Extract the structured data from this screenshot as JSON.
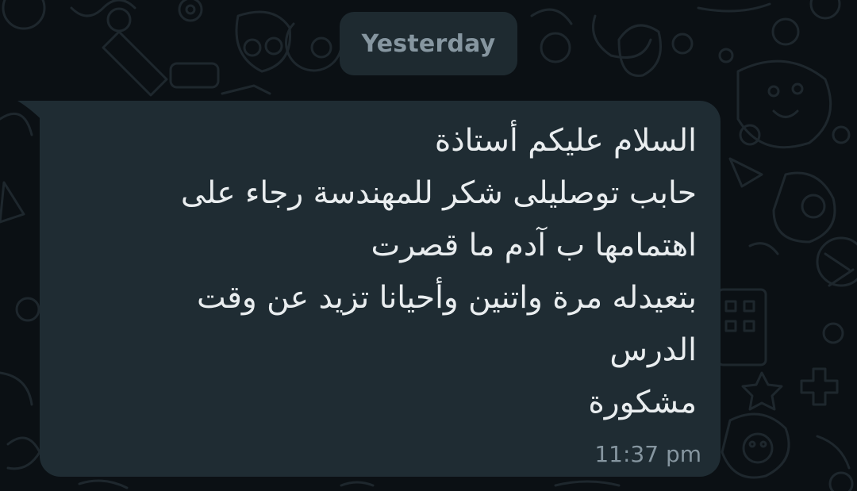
{
  "chat": {
    "date_separator": "Yesterday",
    "message": {
      "lines": [
        "السلام عليكم أستاذة",
        "حابب توصليلى شكر للمهندسة رجاء على",
        "اهتمامها ب آدم ما قصرت",
        " بتعيدله مرة واتنين وأحيانا تزيد عن وقت",
        "الدرس",
        "مشكورة"
      ],
      "time": "11:37 pm",
      "direction": "incoming"
    }
  },
  "colors": {
    "background": "#0b1014",
    "bubble": "#1f2c33",
    "date_chip": "#1e2a30",
    "text": "#e9edef",
    "meta_text": "#8696a0",
    "wallpaper_doodles": "#1e272d"
  },
  "icons": [
    "wallpaper-doodle-pattern"
  ]
}
